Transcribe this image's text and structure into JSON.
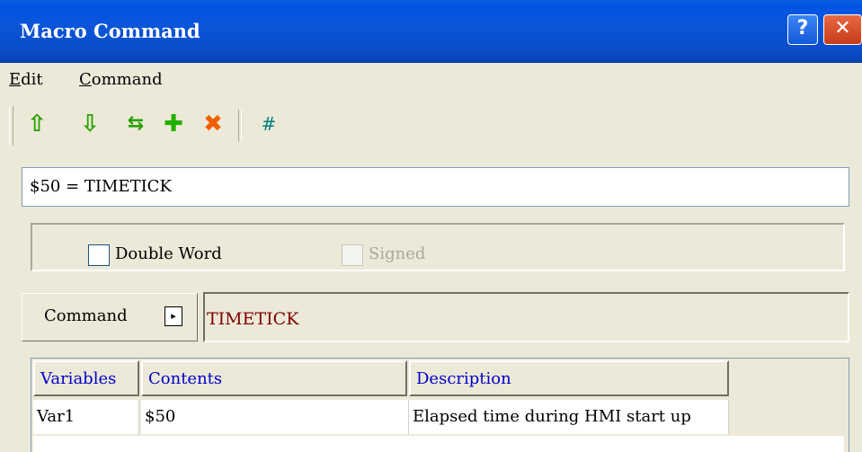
{
  "window": {
    "title": "Macro Command",
    "help_glyph": "?",
    "close_glyph": "✕"
  },
  "menu": {
    "edit": {
      "accel": "E",
      "rest": "dit"
    },
    "command": {
      "accel": "C",
      "rest": "ommand"
    }
  },
  "toolbar": {
    "tools": [
      {
        "icon": "move-up-icon",
        "glyph": "⇧",
        "color": "#2aa000"
      },
      {
        "icon": "move-down-icon",
        "glyph": "⇩",
        "color": "#2aa000"
      },
      {
        "icon": "swap-icon",
        "glyph": "⇆",
        "color": "#2aa000"
      },
      {
        "icon": "add-icon",
        "glyph": "✚",
        "color": "#22b000"
      },
      {
        "icon": "delete-icon",
        "glyph": "✖",
        "color": "#f06000"
      },
      {
        "icon": "hash-icon",
        "glyph": "#",
        "color": "#008080"
      }
    ]
  },
  "expression": "$50 = TIMETICK",
  "options": {
    "double_word": {
      "label": "Double Word",
      "checked": false,
      "enabled": true
    },
    "signed": {
      "label": "Signed",
      "checked": false,
      "enabled": false
    }
  },
  "command": {
    "button_label": "Command",
    "arrow_glyph": "▸",
    "value": "TIMETICK"
  },
  "table": {
    "headers": [
      "Variables",
      "Contents",
      "Description"
    ],
    "rows": [
      [
        "Var1",
        "$50",
        "Elapsed time during HMI start up"
      ]
    ]
  },
  "colors": {
    "title_bar": "#0a55d8",
    "header_text": "#0000c8",
    "command_value": "#800000"
  }
}
